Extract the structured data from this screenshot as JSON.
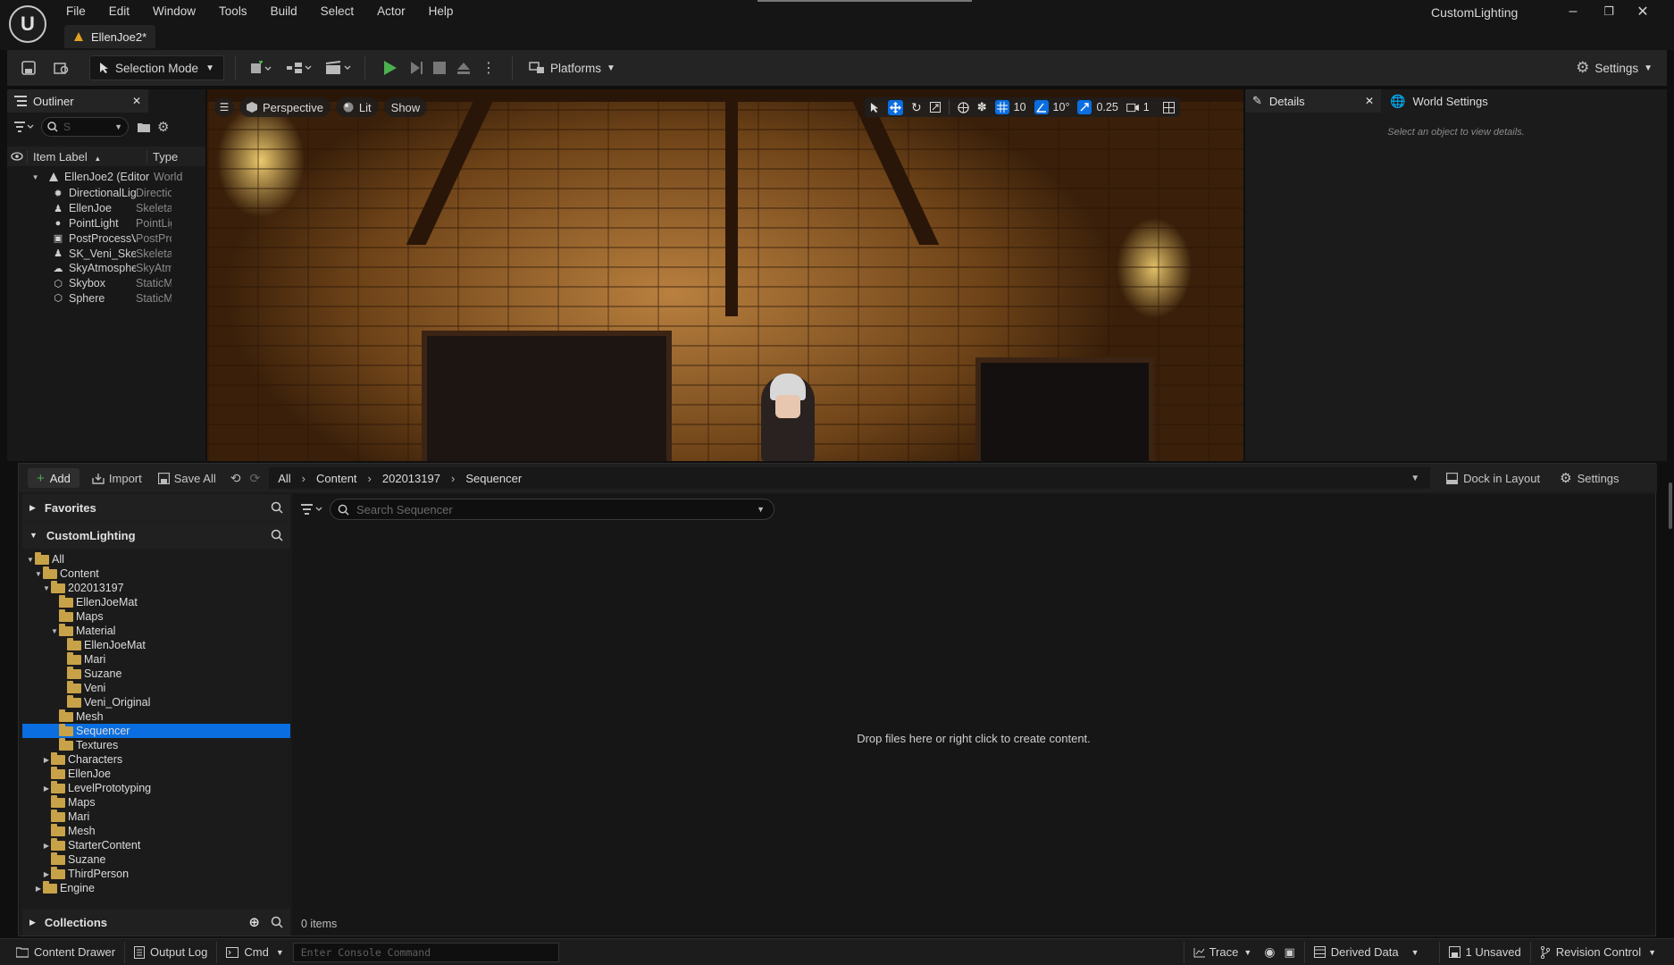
{
  "window": {
    "project_name": "CustomLighting",
    "doc_tab": "EllenJoe2*",
    "menus": [
      "File",
      "Edit",
      "Window",
      "Tools",
      "Build",
      "Select",
      "Actor",
      "Help"
    ]
  },
  "toolbar": {
    "selection_mode": "Selection Mode",
    "platforms": "Platforms",
    "settings": "Settings"
  },
  "outliner": {
    "tab_label": "Outliner",
    "search_value": "S",
    "col_label": "Item Label",
    "col_type": "Type",
    "root": {
      "label": "EllenJoe2 (Editor",
      "type": "World"
    },
    "items": [
      {
        "label": "DirectionalLigl",
        "type": "Directio",
        "icon": "light-icon"
      },
      {
        "label": "EllenJoe",
        "type": "Skeletal",
        "icon": "skeletal-mesh-icon"
      },
      {
        "label": "PointLight",
        "type": "PointLig",
        "icon": "bulb-icon"
      },
      {
        "label": "PostProcessV",
        "type": "PostPro",
        "icon": "volume-icon"
      },
      {
        "label": "SK_Veni_Skele",
        "type": "Skeletal",
        "icon": "skeletal-mesh-icon"
      },
      {
        "label": "SkyAtmospher",
        "type": "SkyAtm",
        "icon": "sky-icon"
      },
      {
        "label": "Skybox",
        "type": "StaticM",
        "icon": "static-mesh-icon"
      },
      {
        "label": "Sphere",
        "type": "StaticM",
        "icon": "static-mesh-icon"
      }
    ]
  },
  "viewport": {
    "perspective": "Perspective",
    "lit": "Lit",
    "show": "Show",
    "grid_snap": "10",
    "rotation_snap": "10°",
    "scale_snap": "0.25",
    "camera_speed": "1"
  },
  "details": {
    "tab_label": "Details",
    "world_settings": "World Settings",
    "empty_message": "Select an object to view details."
  },
  "content_browser": {
    "add": "Add",
    "import": "Import",
    "save_all": "Save All",
    "breadcrumb": [
      "All",
      "Content",
      "202013197",
      "Sequencer"
    ],
    "dock_in_layout": "Dock in Layout",
    "settings": "Settings",
    "favorites": "Favorites",
    "project_section": "CustomLighting",
    "collections": "Collections",
    "search_placeholder": "Search Sequencer",
    "empty_message": "Drop files here or right click to create content.",
    "item_count": "0 items",
    "tree": [
      {
        "label": "All",
        "depth": 0,
        "expanded": true
      },
      {
        "label": "Content",
        "depth": 1,
        "expanded": true
      },
      {
        "label": "202013197",
        "depth": 2,
        "expanded": true
      },
      {
        "label": "EllenJoeMat",
        "depth": 3
      },
      {
        "label": "Maps",
        "depth": 3
      },
      {
        "label": "Material",
        "depth": 3,
        "expanded": true
      },
      {
        "label": "EllenJoeMat",
        "depth": 4
      },
      {
        "label": "Mari",
        "depth": 4
      },
      {
        "label": "Suzane",
        "depth": 4
      },
      {
        "label": "Veni",
        "depth": 4
      },
      {
        "label": "Veni_Original",
        "depth": 4
      },
      {
        "label": "Mesh",
        "depth": 3
      },
      {
        "label": "Sequencer",
        "depth": 3,
        "selected": true
      },
      {
        "label": "Textures",
        "depth": 3
      },
      {
        "label": "Characters",
        "depth": 2,
        "collapsed": true
      },
      {
        "label": "EllenJoe",
        "depth": 2
      },
      {
        "label": "LevelPrototyping",
        "depth": 2,
        "collapsed": true
      },
      {
        "label": "Maps",
        "depth": 2
      },
      {
        "label": "Mari",
        "depth": 2
      },
      {
        "label": "Mesh",
        "depth": 2
      },
      {
        "label": "StarterContent",
        "depth": 2,
        "collapsed": true
      },
      {
        "label": "Suzane",
        "depth": 2
      },
      {
        "label": "ThirdPerson",
        "depth": 2,
        "collapsed": true
      },
      {
        "label": "Engine",
        "depth": 1,
        "collapsed": true
      }
    ]
  },
  "statusbar": {
    "content_drawer": "Content Drawer",
    "output_log": "Output Log",
    "cmd": "Cmd",
    "console_placeholder": "Enter Console Command",
    "trace": "Trace",
    "derived_data": "Derived Data",
    "unsaved": "1 Unsaved",
    "revision_control": "Revision Control"
  },
  "colors": {
    "accent_blue": "#0a6ee0",
    "play_green": "#4caf50",
    "folder": "#c8a248"
  }
}
